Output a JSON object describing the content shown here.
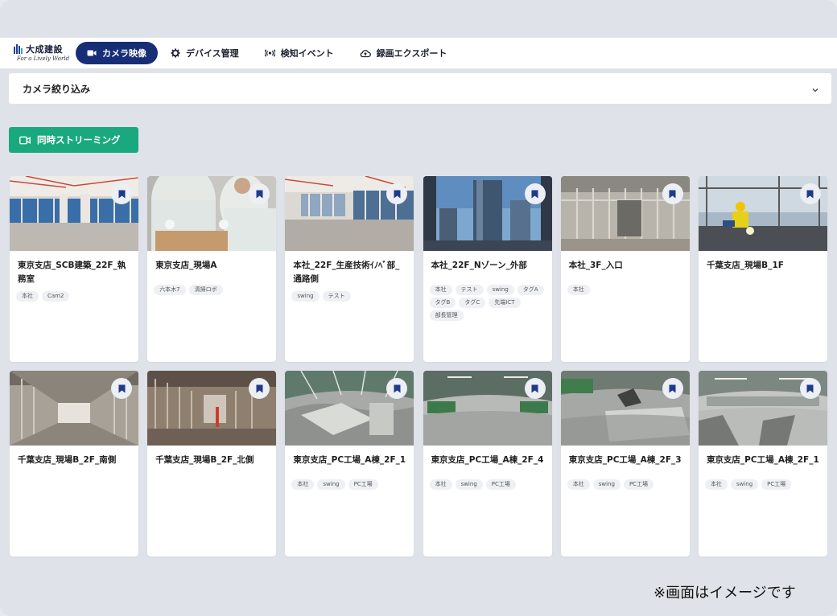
{
  "brand": {
    "name": "大成建設",
    "tagline": "For a Lively World"
  },
  "nav": [
    {
      "label": "カメラ映像",
      "icon": "video-camera-icon",
      "active": true
    },
    {
      "label": "デバイス管理",
      "icon": "gear-icon",
      "active": false
    },
    {
      "label": "検知イベント",
      "icon": "broadcast-icon",
      "active": false
    },
    {
      "label": "録画エクスポート",
      "icon": "cloud-upload-icon",
      "active": false
    }
  ],
  "filter": {
    "label": "カメラ絞り込み",
    "icon": "chevron-down-icon"
  },
  "stream_button": {
    "label": "同時ストリーミング",
    "icon": "video-camera-icon"
  },
  "cameras": [
    {
      "title": "東京支店_SCB建築_22F_執務室",
      "tags": [
        "本社",
        "Cam2"
      ],
      "scene": "office-windows"
    },
    {
      "title": "東京支店_現場A",
      "tags": [
        "六本木7",
        "清掃ロボ"
      ],
      "scene": "workers"
    },
    {
      "title": "本社_22F_生産技術ｲﾉﾍﾞ部_通路側",
      "tags": [
        "swing",
        "テスト"
      ],
      "scene": "empty-floor"
    },
    {
      "title": "本社_22F_Nゾーン_外部",
      "tags": [
        "本社",
        "テスト",
        "swing",
        "タグA",
        "タグB",
        "タグC",
        "先端ICT",
        "部長管理"
      ],
      "scene": "skyscraper"
    },
    {
      "title": "本社_3F_入口",
      "tags": [
        "本社"
      ],
      "scene": "framing"
    },
    {
      "title": "千葉支店_現場B_1F",
      "tags": [],
      "scene": "welder"
    },
    {
      "title": "千葉支店_現場B_2F_南側",
      "tags": [],
      "scene": "corridor"
    },
    {
      "title": "千葉支店_現場B_2F_北側",
      "tags": [],
      "scene": "studs"
    },
    {
      "title": "東京支店_PC工場_A棟_2F_1",
      "tags": [
        "本社",
        "swing",
        "PC工場"
      ],
      "scene": "factory-fisheye"
    },
    {
      "title": "東京支店_PC工場_A棟_2F_4",
      "tags": [
        "本社",
        "swing",
        "PC工場"
      ],
      "scene": "warehouse"
    },
    {
      "title": "東京支店_PC工場_A棟_2F_3",
      "tags": [
        "本社",
        "swing",
        "PC工場"
      ],
      "scene": "panel"
    },
    {
      "title": "東京支店_PC工場_A棟_2F_1",
      "tags": [
        "本社",
        "swing",
        "PC工場"
      ],
      "scene": "hall"
    }
  ],
  "note": "※画面はイメージです",
  "colors": {
    "nav_active": "#172e76",
    "stream_button": "#1aa97e",
    "bookmark": "#1f3a8a",
    "background": "#dfe3e9"
  }
}
